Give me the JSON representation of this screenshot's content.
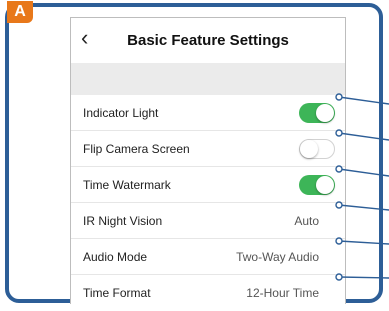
{
  "badge": "A",
  "header": {
    "title": "Basic Feature Settings",
    "back_icon": "chevron-left-icon"
  },
  "rows": [
    {
      "label": "Indicator Light",
      "control": "toggle",
      "on": true
    },
    {
      "label": "Flip Camera Screen",
      "control": "toggle",
      "on": false
    },
    {
      "label": "Time Watermark",
      "control": "toggle",
      "on": true
    },
    {
      "label": "IR Night Vision",
      "control": "value",
      "value": "Auto"
    },
    {
      "label": "Audio Mode",
      "control": "value",
      "value": "Two-Way Audio"
    },
    {
      "label": "Time Format",
      "control": "value",
      "value": "12-Hour Time"
    }
  ],
  "colors": {
    "frame": "#2d5e97",
    "badge": "#e8781a",
    "toggle_on": "#3db558",
    "callout": "#2d5e97"
  }
}
